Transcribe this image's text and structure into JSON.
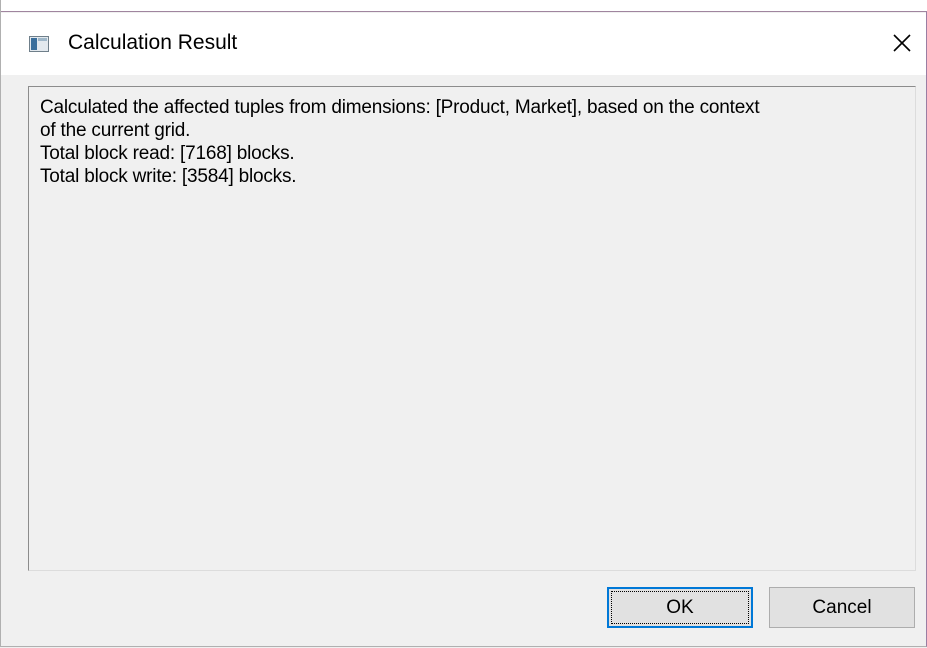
{
  "window": {
    "title": "Calculation Result",
    "icon": "app-window-icon",
    "close_icon": "close-icon"
  },
  "message": {
    "lines": [
      "Calculated the affected tuples from dimensions: [Product, Market], based on the context",
      "of the current grid.",
      "Total block read: [7168] blocks.",
      "Total block write: [3584] blocks."
    ]
  },
  "buttons": {
    "ok_label": "OK",
    "cancel_label": "Cancel"
  },
  "colors": {
    "accent": "#0078d7",
    "dialog_background": "#f0f0f0",
    "titlebar_background": "#ffffff"
  }
}
